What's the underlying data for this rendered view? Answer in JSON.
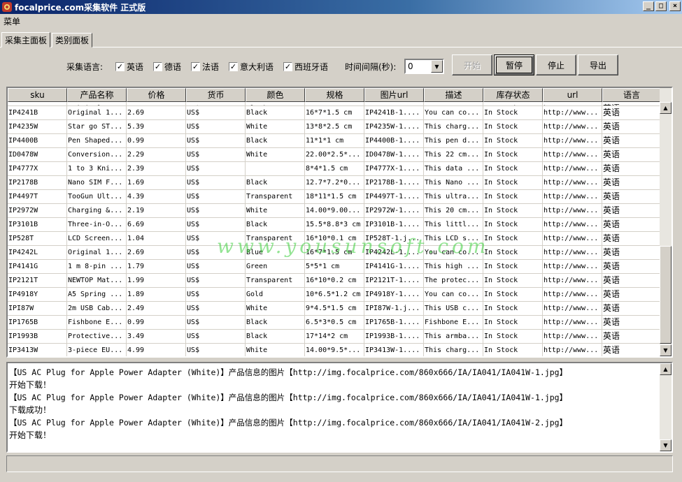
{
  "window": {
    "title": "focalprice.com采集软件  正式版",
    "buttons": {
      "minimize": "_",
      "maximize": "□",
      "close": "×"
    }
  },
  "menu": {
    "label": "菜单"
  },
  "tabs": [
    {
      "label": "采集主面板",
      "active": true
    },
    {
      "label": "类别面板",
      "active": false
    }
  ],
  "options": {
    "lang_label": "采集语言:",
    "languages": [
      {
        "label": "英语",
        "checked": true
      },
      {
        "label": "德语",
        "checked": true
      },
      {
        "label": "法语",
        "checked": true
      },
      {
        "label": "意大利语",
        "checked": true
      },
      {
        "label": "西班牙语",
        "checked": true
      }
    ],
    "interval_label": "时间间隔(秒):",
    "interval_value": "0",
    "check_mark": "✓"
  },
  "buttons": {
    "start": "开始",
    "pause": "暂停",
    "stop": "停止",
    "export": "导出"
  },
  "table": {
    "columns": [
      "sku",
      "产品名称",
      "价格",
      "货币",
      "颜色",
      "规格",
      "图片url",
      "描述",
      "库存状态",
      "url",
      "语言"
    ],
    "partial_row": [
      "IP4241B",
      "Original 1...",
      "2.69",
      "US$",
      "Black",
      "16*7*1.5 cm",
      "IP4241B-1....",
      "You can co...",
      "In Stock",
      "http://www...",
      "英语"
    ],
    "rows": [
      [
        "IP4241B",
        "Original 1...",
        "2.69",
        "US$",
        "Black",
        "16*7*1.5 cm",
        "IP4241B-1....",
        "You can co...",
        "In Stock",
        "http://www...",
        "英语"
      ],
      [
        "IP4235W",
        "Star go ST...",
        "5.39",
        "US$",
        "White",
        "13*8*2.5 cm",
        "IP4235W-1....",
        "This charg...",
        "In Stock",
        "http://www...",
        "英语"
      ],
      [
        "IP4400B",
        "Pen Shaped...",
        "0.99",
        "US$",
        "Black",
        "11*1*1 cm",
        "IP4400B-1....",
        "This pen d...",
        "In Stock",
        "http://www...",
        "英语"
      ],
      [
        "ID0478W",
        "Conversion...",
        "2.29",
        "US$",
        "White",
        "22.00*2.5*...",
        "ID0478W-1....",
        "This 22 cm...",
        "In Stock",
        "http://www...",
        "英语"
      ],
      [
        "IP4777X",
        "1 to 3 Kni...",
        "2.39",
        "US$",
        "",
        "8*4*1.5 cm",
        "IP4777X-1....",
        "This data ...",
        "In Stock",
        "http://www...",
        "英语"
      ],
      [
        "IP2178B",
        "Nano SIM F...",
        "1.69",
        "US$",
        "Black",
        "12.7*7.2*0...",
        "IP2178B-1....",
        "This Nano ...",
        "In Stock",
        "http://www...",
        "英语"
      ],
      [
        "IP4497T",
        "TooGun Ult...",
        "4.39",
        "US$",
        "Transparent",
        "18*11*1.5 cm",
        "IP4497T-1....",
        "This ultra...",
        "In Stock",
        "http://www...",
        "英语"
      ],
      [
        "IP2972W",
        "Charging &...",
        "2.19",
        "US$",
        "White",
        "14.00*9.00...",
        "IP2972W-1....",
        "This 20 cm...",
        "In Stock",
        "http://www...",
        "英语"
      ],
      [
        "IP3101B",
        "Three-in-O...",
        "6.69",
        "US$",
        "Black",
        "15.5*8.8*3 cm",
        "IP3101B-1....",
        "This littl...",
        "In Stock",
        "http://www...",
        "英语"
      ],
      [
        "IP528T",
        "LCD Screen...",
        "1.04",
        "US$",
        "Transparent",
        "16*10*0.1 cm",
        "IP528T-1.j...",
        "This LCD s...",
        "In Stock",
        "http://www...",
        "英语"
      ],
      [
        "IP4242L",
        "Original 1...",
        "2.69",
        "US$",
        "Blue",
        "16*7*1.5 cm",
        "IP4242L-1....",
        "You can co...",
        "In Stock",
        "http://www...",
        "英语"
      ],
      [
        "IP4141G",
        "1 m 8-pin ...",
        "1.79",
        "US$",
        "Green",
        "5*5*1 cm",
        "IP4141G-1....",
        "This high ...",
        "In Stock",
        "http://www...",
        "英语"
      ],
      [
        "IP2121T",
        "NEWTOP Mat...",
        "1.99",
        "US$",
        "Transparent",
        "16*10*0.2 cm",
        "IP2121T-1....",
        "The protec...",
        "In Stock",
        "http://www...",
        "英语"
      ],
      [
        "IP4918Y",
        "A5 Spring ...",
        "1.89",
        "US$",
        "Gold",
        "10*6.5*1.2 cm",
        "IP4918Y-1....",
        "You can co...",
        "In Stock",
        "http://www...",
        "英语"
      ],
      [
        "IPI87W",
        "2m USB Cab...",
        "2.49",
        "US$",
        "White",
        "9*4.5*1.5 cm",
        "IPI87W-1.j...",
        "This USB c...",
        "In Stock",
        "http://www...",
        "英语"
      ],
      [
        "IP1765B",
        "Fishbone E...",
        "0.99",
        "US$",
        "Black",
        "6.5*3*0.5 cm",
        "IP1765B-1....",
        "Fishbone E...",
        "In Stock",
        "http://www...",
        "英语"
      ],
      [
        "IP1993B",
        "Protective...",
        "3.49",
        "US$",
        "Black",
        "17*14*2 cm",
        "IP1993B-1....",
        "This armba...",
        "In Stock",
        "http://www...",
        "英语"
      ],
      [
        "IP3413W",
        "3-piece EU...",
        "4.99",
        "US$",
        "White",
        "14.00*9.5*...",
        "IP3413W-1....",
        "This charg...",
        "In Stock",
        "http://www...",
        "英语"
      ]
    ]
  },
  "watermark": "www.yousunsoft.com",
  "log": [
    "【US AC Plug for Apple Power Adapter (White)】产品信息的图片【http://img.focalprice.com/860x666/IA/IA041/IA041W-1.jpg】",
    "开始下载！",
    "【US AC Plug for Apple Power Adapter (White)】产品信息的图片【http://img.focalprice.com/860x666/IA/IA041/IA041W-1.jpg】",
    "下载成功！",
    "【US AC Plug for Apple Power Adapter (White)】产品信息的图片【http://img.focalprice.com/860x666/IA/IA041/IA041W-2.jpg】",
    "开始下载！"
  ],
  "scroll": {
    "up": "▲",
    "down": "▼",
    "combo_arrow": "▼"
  }
}
